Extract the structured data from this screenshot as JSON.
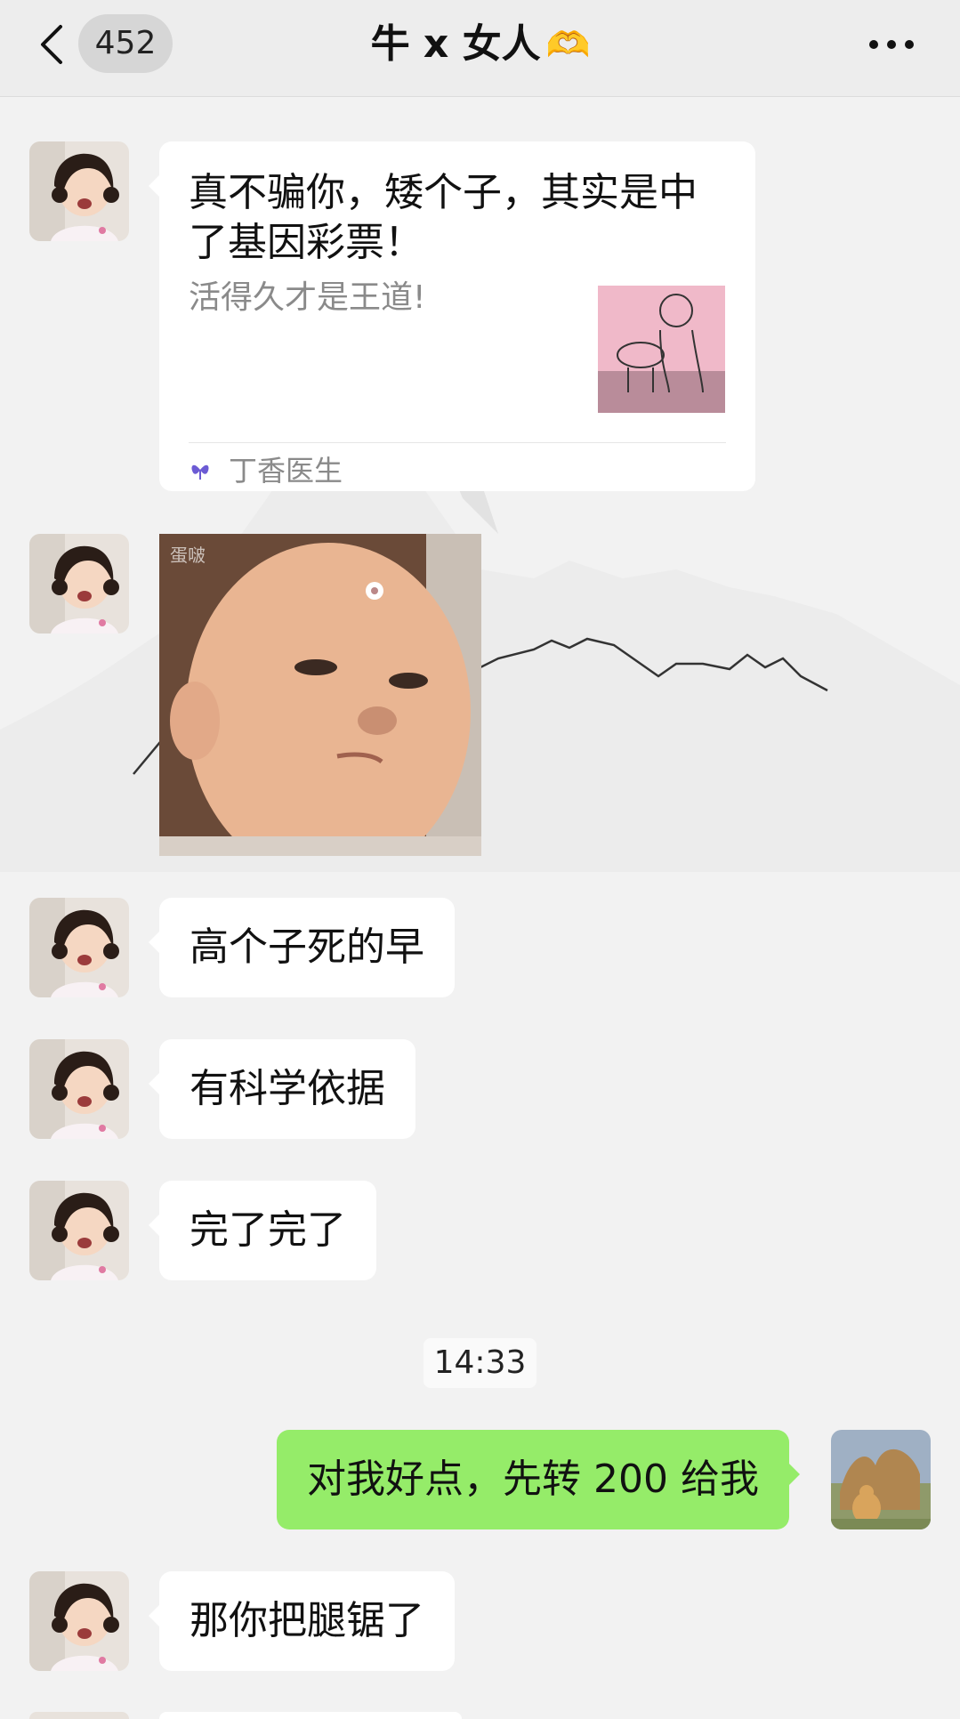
{
  "header": {
    "unread_count": "452",
    "title": "牛 x 女人",
    "title_emoji": "🫶"
  },
  "messages": {
    "card": {
      "title": "真不骗你，矮个子，其实是中了基因彩票！",
      "description": "活得久才是王道!",
      "source": "丁香医生"
    },
    "photo": {
      "watermark": "蛋啵"
    },
    "msg1": "高个子死的早",
    "msg2": "有科学依据",
    "msg3": "完了完了",
    "timestamp": "14:33",
    "my_msg": "对我好点，先转 200 给我",
    "msg4": "那你把腿锯了"
  },
  "colors": {
    "bubble_mine": "#95ec69",
    "bubble_other": "#ffffff",
    "background": "#f2f2f2",
    "header": "#ededed"
  }
}
